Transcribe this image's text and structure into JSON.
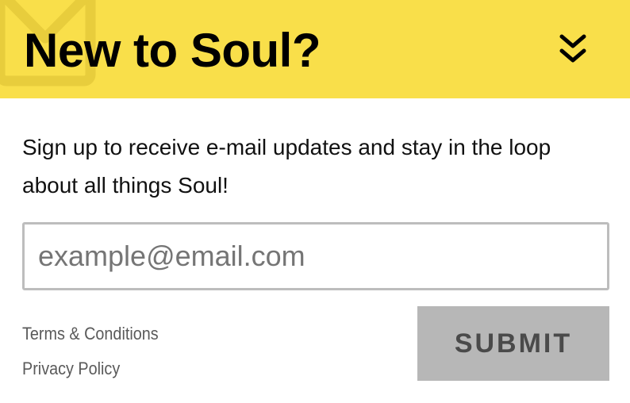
{
  "colors": {
    "header_bg": "#f9df4a",
    "envelope": "#e8cd3c",
    "submit_bg": "#b7b7b7"
  },
  "header": {
    "title": "New to Soul?",
    "collapse_icon": "double-chevron-down-icon",
    "decor_icon": "envelope-icon"
  },
  "signup": {
    "description": "Sign up to receive e-mail updates and stay in the loop about all things Soul!",
    "email_placeholder": "example@email.com",
    "email_value": ""
  },
  "footer": {
    "terms_label": "Terms & Conditions",
    "privacy_label": "Privacy Policy",
    "submit_label": "SUBMIT"
  }
}
